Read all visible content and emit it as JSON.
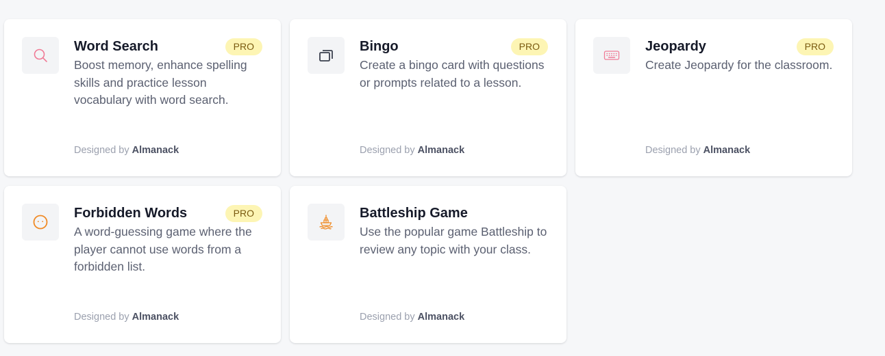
{
  "colors": {
    "page_background": "#f6f7f9",
    "card_background": "#ffffff",
    "pro_badge_background": "#fdf5b4",
    "pro_badge_text": "#7a5a10"
  },
  "cards": [
    {
      "title": "Word Search",
      "badge": "PRO",
      "description": "Boost memory, enhance spelling skills and practice lesson vocabulary with word search.",
      "footer_prefix": "Designed by",
      "author": "Almanack",
      "icon": "search-icon",
      "icon_color": "#f07a95"
    },
    {
      "title": "Bingo",
      "badge": "PRO",
      "description": "Create a bingo card with questions or prompts related to a lesson.",
      "footer_prefix": "Designed by",
      "author": "Almanack",
      "icon": "cards-stack-icon",
      "icon_color": "#3a3f4d"
    },
    {
      "title": "Jeopardy",
      "badge": "PRO",
      "description": "Create Jeopardy for the classroom.",
      "footer_prefix": "Designed by",
      "author": "Almanack",
      "icon": "keyboard-icon",
      "icon_color": "#f07a95"
    },
    {
      "title": "Forbidden Words",
      "badge": "PRO",
      "description": "A word-guessing game where the player cannot use words from a forbidden list.",
      "footer_prefix": "Designed by",
      "author": "Almanack",
      "icon": "face-icon",
      "icon_color": "#f08a24"
    },
    {
      "title": "Battleship Game",
      "description": "Use the popular game Battleship to review any topic with your class.",
      "footer_prefix": "Designed by",
      "author": "Almanack",
      "icon": "ship-icon",
      "icon_color": "#f08a24"
    }
  ]
}
